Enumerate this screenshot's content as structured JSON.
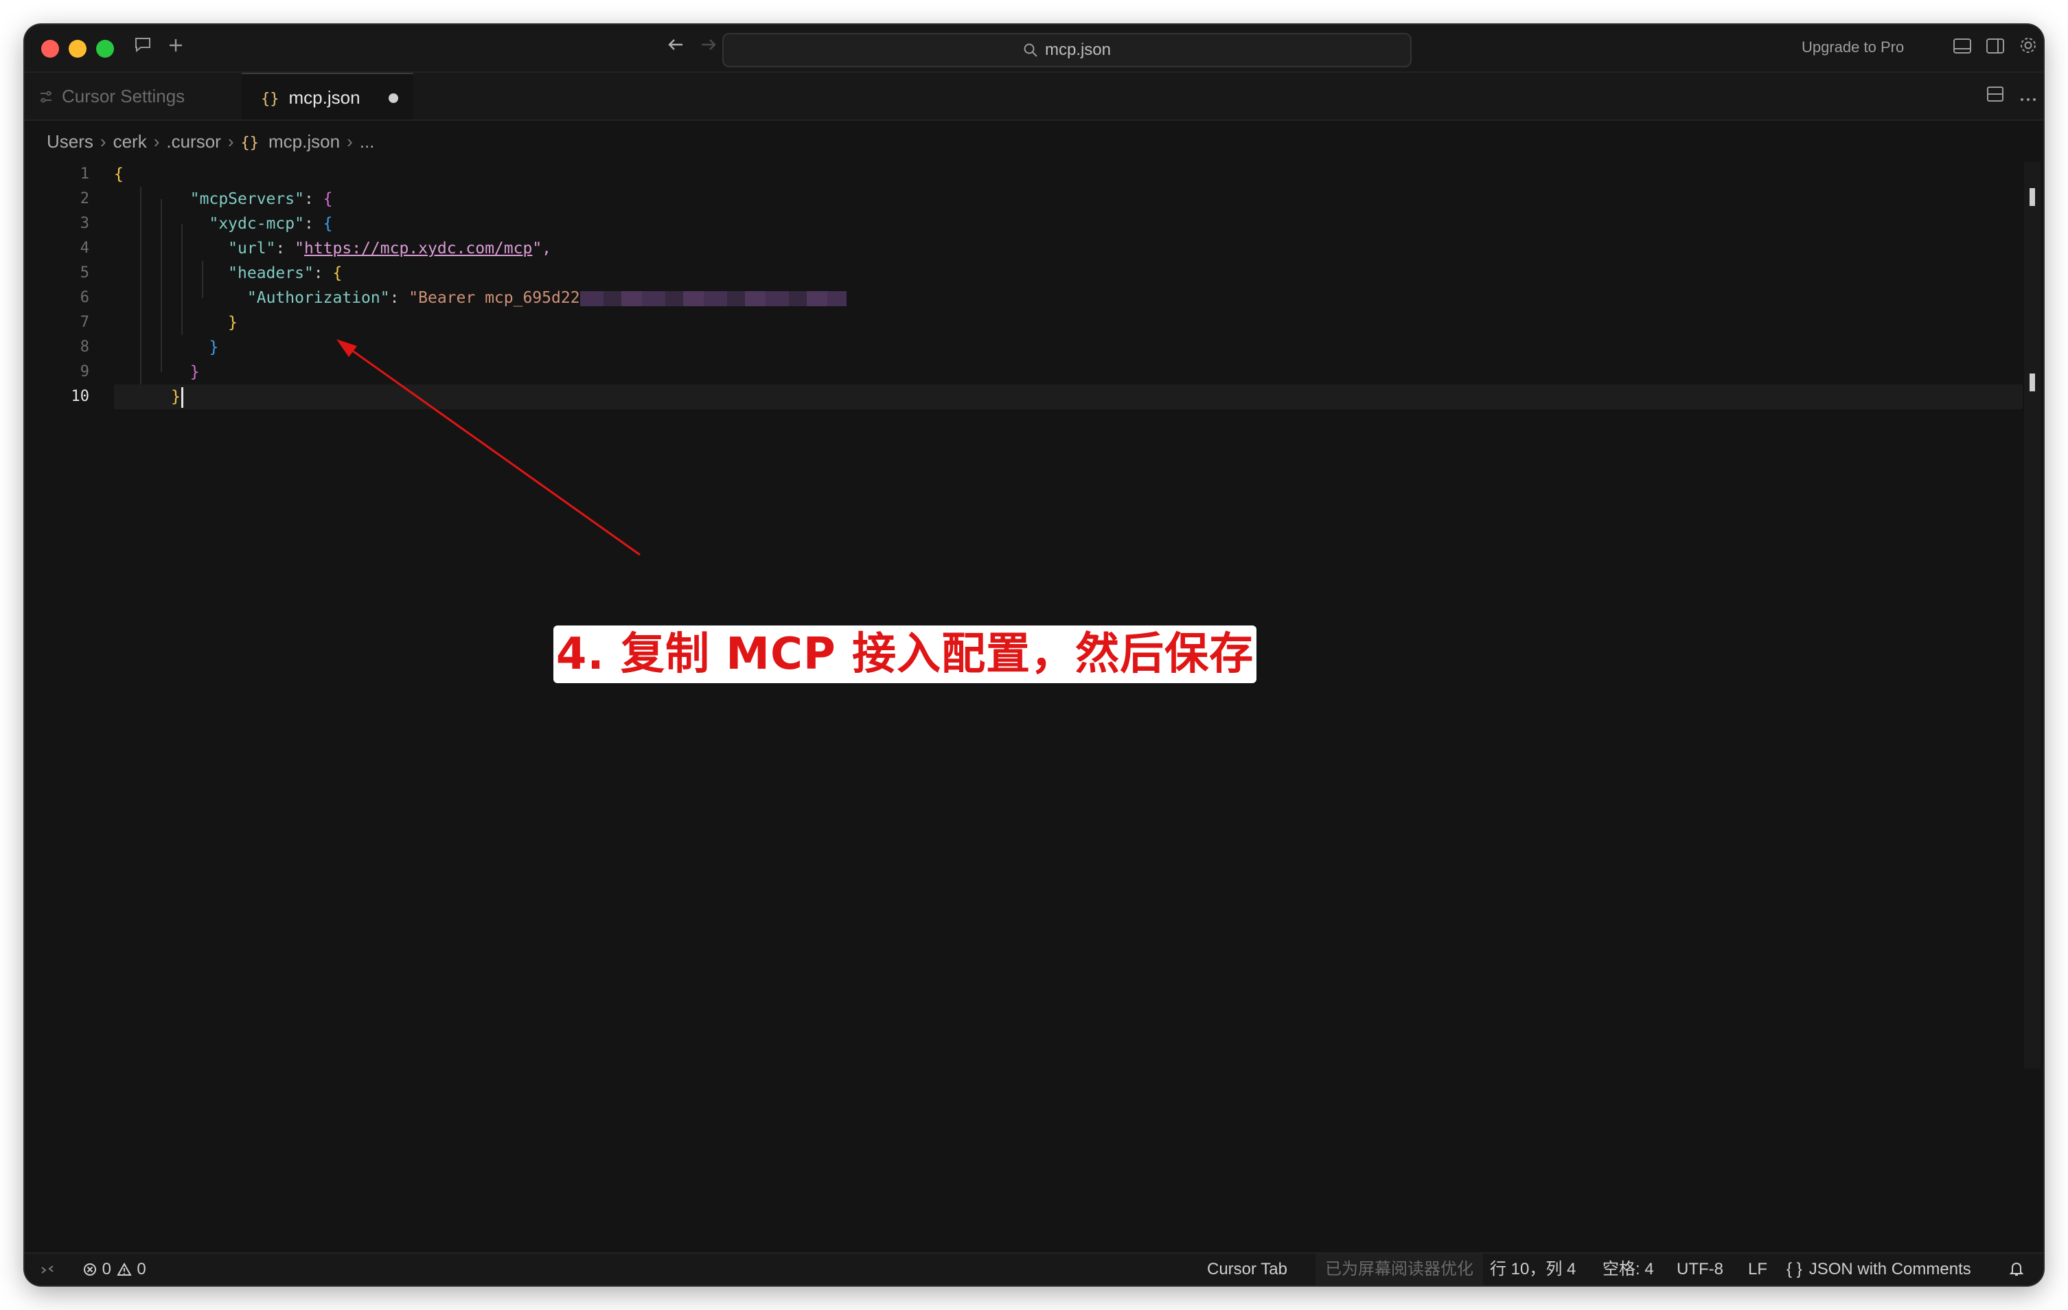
{
  "titlebar": {
    "search_text": "mcp.json",
    "upgrade_label": "Upgrade to Pro"
  },
  "tabs": [
    {
      "label": "Cursor Settings",
      "icon": "settings-icon"
    },
    {
      "label": "mcp.json",
      "icon": "json-braces-icon",
      "dirty": true
    }
  ],
  "tab_icon_text": "{}",
  "breadcrumb": [
    "Users",
    "cerk",
    ".cursor",
    "mcp.json",
    "..."
  ],
  "editor": {
    "line_numbers": [
      "1",
      "2",
      "3",
      "4",
      "5",
      "6",
      "7",
      "8",
      "9",
      "10"
    ],
    "active_line": 10,
    "code": {
      "l1_open": "{",
      "l2_key": "\"mcpServers\"",
      "l2_colon": ": ",
      "l2_open": "{",
      "l3_key": "\"xydc-mcp\"",
      "l3_colon": ": ",
      "l3_open": "{",
      "l4_key": "\"url\"",
      "l4_colon": ": ",
      "l4_q1": "\"",
      "l4_url": "https://mcp.xydc.com/mcp",
      "l4_q2": "\",",
      "l5_key": "\"headers\"",
      "l5_colon": ": ",
      "l5_open": "{",
      "l6_key": "\"Authorization\"",
      "l6_colon": ": ",
      "l6_value": "\"Bearer mcp_695d22",
      "l7_close": "}",
      "l8_close": "}",
      "l9_close": "}",
      "l10_close": "}"
    }
  },
  "annotation": {
    "text": "4. 复制 MCP 接入配置，然后保存",
    "color": "#e01515"
  },
  "statusbar": {
    "errors": "0",
    "warnings": "0",
    "cursor_tab": "Cursor Tab",
    "screen_reader": "已为屏幕阅读器优化",
    "position": "行 10，列 4",
    "spaces": "空格: 4",
    "encoding": "UTF-8",
    "eol": "LF",
    "language_icon": "{ }",
    "language": "JSON with Comments"
  },
  "colors": {
    "background": "#141414",
    "key": "#80cbc4",
    "string": "#ce9178",
    "bracket_gold": "#f3c74a",
    "bracket_magenta": "#d16fd1",
    "bracket_blue": "#3d9bf0"
  }
}
